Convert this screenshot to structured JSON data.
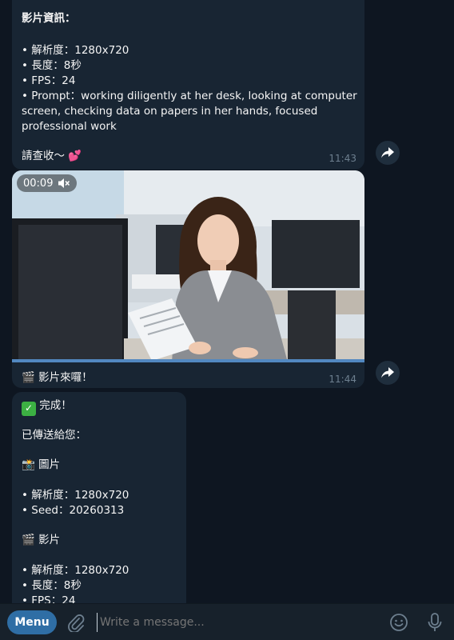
{
  "message1": {
    "title": "影片資訊：",
    "lines": [
      "• 解析度：1280x720",
      "• 長度：8秒",
      "• FPS：24",
      "• Prompt：working diligently at her desk, looking at computer",
      "screen, checking data on papers in her hands, focused",
      "professional work"
    ],
    "closing": "請查收～",
    "closing_emoji": "💕",
    "time": "11:43"
  },
  "message2": {
    "video_timer": "00:09",
    "video_progress": 1.0,
    "caption_emoji": "🎬",
    "caption": "影片來囉！",
    "time": "11:44"
  },
  "message3": {
    "check_emoji": "✅",
    "done": "完成！",
    "sent": "已傳送給您：",
    "image_emoji": "📸",
    "image_label": "圖片",
    "image_lines": [
      "• 解析度：1280x720",
      "• Seed：20260313"
    ],
    "video_emoji": "🎬",
    "video_label": "影片",
    "video_lines": [
      "• 解析度：1280x720",
      "• 長度：8秒",
      "• FPS：24"
    ]
  },
  "bottom": {
    "menu_label": "Menu",
    "input_placeholder": "Write a message..."
  },
  "colors": {
    "background": "#0e1621",
    "bubble": "#182533",
    "accent": "#2f6ea5",
    "progress": "#5288c1"
  }
}
